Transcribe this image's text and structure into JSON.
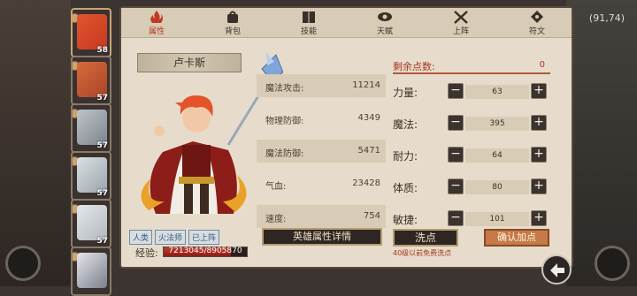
{
  "background": {
    "coord": "(91,74)"
  },
  "tabs": [
    {
      "label": "属性",
      "icon": "flame-icon",
      "active": true
    },
    {
      "label": "背包",
      "icon": "bag-icon",
      "active": false
    },
    {
      "label": "技能",
      "icon": "book-icon",
      "active": false
    },
    {
      "label": "天赋",
      "icon": "eye-icon",
      "active": false
    },
    {
      "label": "上阵",
      "icon": "crossed-swords-icon",
      "active": false
    },
    {
      "label": "符文",
      "icon": "rune-icon",
      "active": false
    }
  ],
  "heroes": [
    {
      "level": "58",
      "colors": [
        "#e0562f",
        "#c73820"
      ]
    },
    {
      "level": "57",
      "colors": [
        "#d86a3b",
        "#a84528"
      ]
    },
    {
      "level": "57",
      "colors": [
        "#bfc4c8",
        "#7c858d"
      ]
    },
    {
      "level": "57",
      "colors": [
        "#dbe1e4",
        "#9aa4ab"
      ]
    },
    {
      "level": "57",
      "colors": [
        "#e4e7ea",
        "#b1b8be"
      ]
    },
    {
      "level": "",
      "colors": [
        "#e5e6ea",
        "#7a7f8a"
      ]
    }
  ],
  "hero_name": "卢卡斯",
  "tags": [
    "人类",
    "火法师",
    "已上阵"
  ],
  "exp": {
    "label": "经验:",
    "text": "7213045/8905870",
    "fraction": 0.81
  },
  "stats": [
    {
      "label": "魔法攻击:",
      "value": "11214"
    },
    {
      "label": "物理防御:",
      "value": "4349"
    },
    {
      "label": "魔法防御:",
      "value": "5471"
    },
    {
      "label": "气血:",
      "value": "23428"
    },
    {
      "label": "速度:",
      "value": "754"
    }
  ],
  "detail_button": "英雄属性详情",
  "remaining": {
    "label": "剩余点数:",
    "value": "0"
  },
  "attributes": [
    {
      "label": "力量:",
      "value": "63"
    },
    {
      "label": "魔法:",
      "value": "395"
    },
    {
      "label": "耐力:",
      "value": "64"
    },
    {
      "label": "体质:",
      "value": "80"
    },
    {
      "label": "敏捷:",
      "value": "101"
    }
  ],
  "minus_symbol": "−",
  "plus_symbol": "+",
  "wash_button": "洗点",
  "wash_note": "40级以前免费洗点",
  "confirm_button": "确认加点",
  "colors": {
    "accent": "#a8361f",
    "panel": "#e7dccb",
    "confirm": "#c57a47"
  }
}
